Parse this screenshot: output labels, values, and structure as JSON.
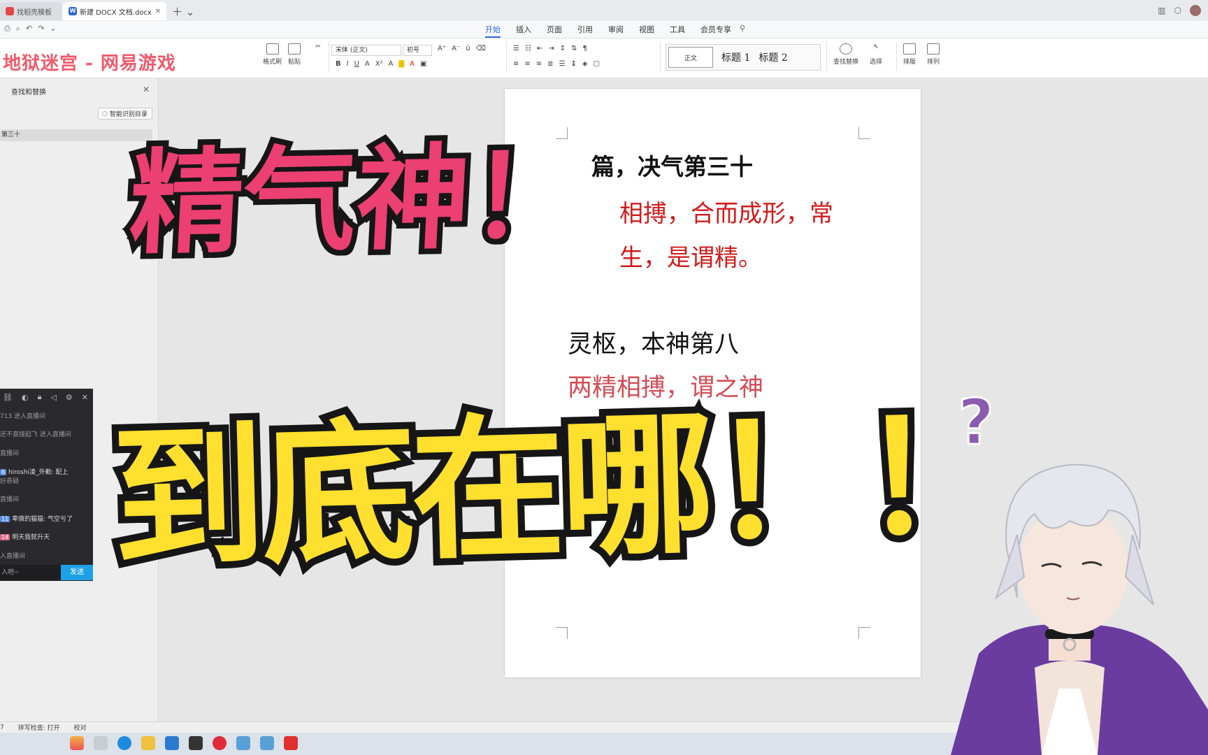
{
  "tabs": [
    {
      "label": "找稻壳模板"
    },
    {
      "label": "新建 DOCX 文档.docx"
    }
  ],
  "menu": {
    "tabs": [
      "开始",
      "插入",
      "页面",
      "引用",
      "审阅",
      "视图",
      "工具",
      "会员专享"
    ],
    "active": "开始"
  },
  "ribbon": {
    "format_painter": "格式刷",
    "paste": "粘贴",
    "font_name": "宋体 (正文)",
    "font_size": "初号",
    "styles": [
      "正文",
      "标题 1",
      "标题 2"
    ],
    "find_replace": "查找替换",
    "select": "选择",
    "layout": "排版",
    "arrange": "排列"
  },
  "overlay_brand": "地狱迷宫 - 网易游戏",
  "nav_panel": {
    "title": "查找和替换",
    "smart_toc": "智能识别目录",
    "toc_item": "第三十"
  },
  "document": {
    "heading1": "篇，决气第三十",
    "para1": "相搏，合而成形，常",
    "para2": "生，是谓精。",
    "heading2": "灵枢，本神第八",
    "para3": "两精相搏，谓之神"
  },
  "chat": {
    "lines": [
      {
        "text": "713 进入直播间"
      },
      {
        "text": "还不直接起飞 进入直播间"
      },
      {
        "text": "直播间"
      },
      {
        "badge": "6",
        "user": "hiroshi凌_外勤:",
        "msg": "配上"
      },
      {
        "text": "好悬疑"
      },
      {
        "text": "直播间"
      },
      {
        "badge": "11",
        "user": "卑微的猫猫:",
        "msg": "气空亏了"
      },
      {
        "badge": "14",
        "user": "",
        "msg": "明天我就升天"
      },
      {
        "text": "入直播间"
      }
    ],
    "input_placeholder": "入吧~",
    "send_label": "发送"
  },
  "statusbar": {
    "page": "7",
    "spell": "拼写检查: 打开",
    "proof": "校对"
  },
  "headline1": "精气神！",
  "headline2": "到底在哪！！",
  "colors": {
    "headline1": "#ec3f72",
    "headline2": "#ffe02e",
    "outline": "#161616",
    "doc_red": "#d11b1b",
    "accent": "#2d6be0"
  }
}
